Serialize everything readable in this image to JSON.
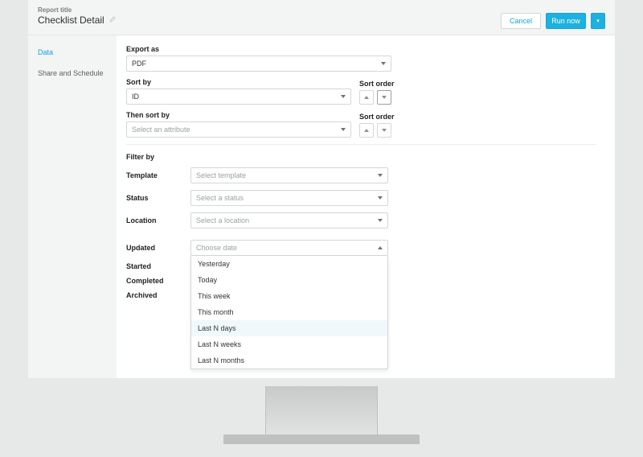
{
  "header": {
    "title_label": "Report title",
    "title_value": "Checklist Detail",
    "cancel_label": "Cancel",
    "run_label": "Run now"
  },
  "sidebar": {
    "items": [
      {
        "label": "Data",
        "active": true
      },
      {
        "label": "Share and Schedule",
        "active": false
      }
    ]
  },
  "export": {
    "label": "Export as",
    "value": "PDF"
  },
  "sort": {
    "label": "Sort by",
    "value": "ID",
    "order_label": "Sort order"
  },
  "then_sort": {
    "label": "Then sort by",
    "placeholder": "Select an attribute",
    "order_label": "Sort order"
  },
  "filter": {
    "section_label": "Filter by",
    "rows": [
      {
        "key": "template",
        "label": "Template",
        "placeholder": "Select template"
      },
      {
        "key": "status",
        "label": "Status",
        "placeholder": "Select a status"
      },
      {
        "key": "location",
        "label": "Location",
        "placeholder": "Select a location"
      }
    ],
    "date_rows": [
      {
        "key": "updated",
        "label": "Updated",
        "placeholder": "Choose date",
        "open": true
      },
      {
        "key": "started",
        "label": "Started"
      },
      {
        "key": "completed",
        "label": "Completed"
      },
      {
        "key": "archived",
        "label": "Archived"
      }
    ],
    "date_options": [
      "Yesterday",
      "Today",
      "This week",
      "This month",
      "Last N days",
      "Last N weeks",
      "Last N months"
    ],
    "highlighted_option_index": 4
  }
}
